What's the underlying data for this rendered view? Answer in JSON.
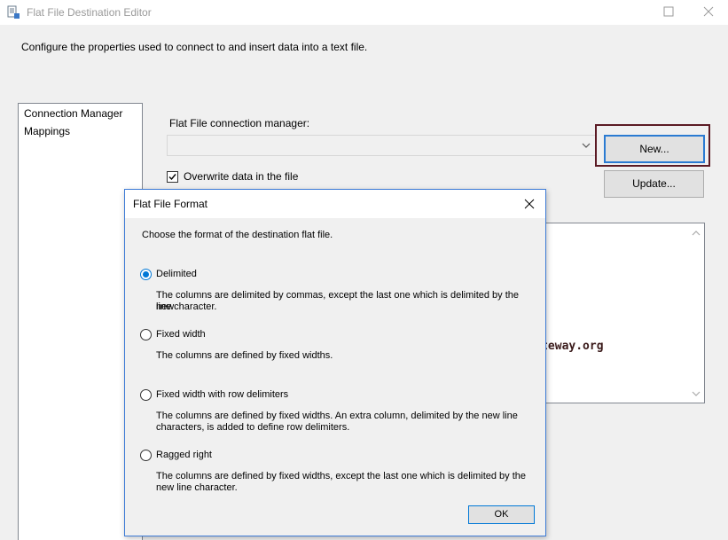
{
  "window": {
    "title": "Flat File Destination Editor",
    "description": "Configure the properties used to connect to and insert data into a text file."
  },
  "sidebar": {
    "items": [
      {
        "label": "Connection Manager",
        "selected": true
      },
      {
        "label": "Mappings",
        "selected": false
      }
    ]
  },
  "connection": {
    "label": "Flat File connection manager:",
    "value": "",
    "new_label": "New...",
    "update_label": "Update...",
    "overwrite_label": "Overwrite data in the file",
    "overwrite_checked": true
  },
  "watermark": "©tutorialgateway.org",
  "dialog": {
    "title": "Flat File Format",
    "instruction": "Choose the format of the destination flat file.",
    "options": [
      {
        "label": "Delimited",
        "checked": true,
        "desc_line1": "The columns are delimited by commas, except the last one which is delimited by the new",
        "desc_line2": "line character."
      },
      {
        "label": "Fixed width",
        "checked": false,
        "desc_line1": "The columns are defined by fixed widths.",
        "desc_line2": ""
      },
      {
        "label": "Fixed width with row delimiters",
        "checked": false,
        "desc_line1": "The columns are defined by fixed widths. An extra column, delimited by the new line",
        "desc_line2": "characters, is added to define row delimiters."
      },
      {
        "label": "Ragged right",
        "checked": false,
        "desc_line1": "The columns are defined by fixed widths, except the last one which is delimited by the",
        "desc_line2": "new line character."
      }
    ],
    "ok_label": "OK"
  },
  "colors": {
    "accent": "#0078d7",
    "highlight_box": "#5b1a24"
  }
}
